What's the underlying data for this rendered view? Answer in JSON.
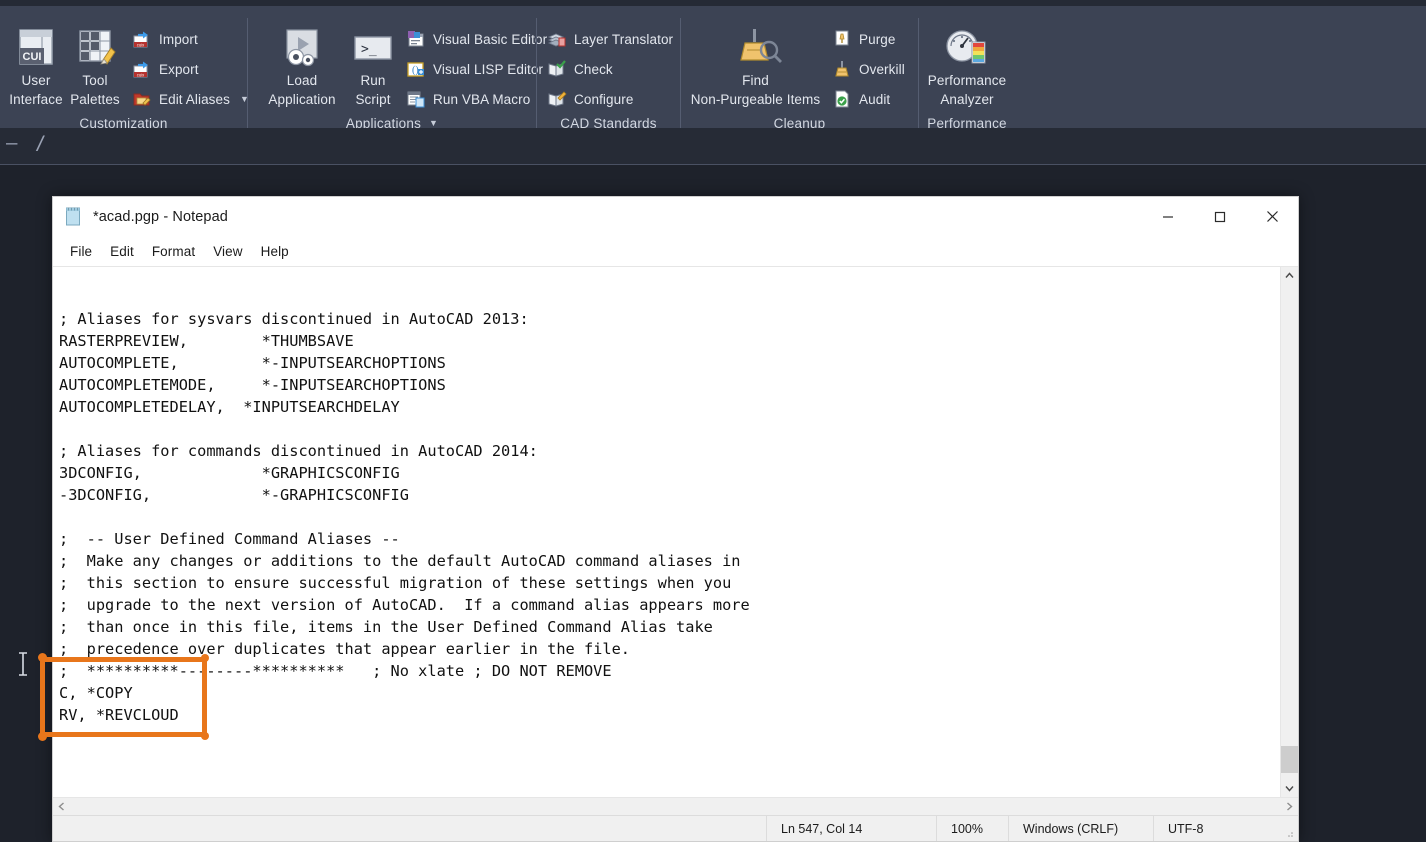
{
  "app": {
    "name": "AutoCAD",
    "command_prompt": "–  /"
  },
  "ribbon": {
    "panels": [
      {
        "id": "customization",
        "title": "Customization",
        "has_dropdown": false,
        "big_buttons": [
          {
            "icon": "cui-user-interface-icon",
            "label_line1": "User",
            "label_line2": "Interface"
          },
          {
            "icon": "tool-palettes-icon",
            "label_line1": "Tool",
            "label_line2": "Palettes"
          }
        ],
        "small_buttons": [
          {
            "icon": "import-cuix-icon",
            "label": "Import",
            "dropdown": false
          },
          {
            "icon": "export-cuix-icon",
            "label": "Export",
            "dropdown": false
          },
          {
            "icon": "edit-aliases-icon",
            "label": "Edit Aliases",
            "dropdown": true
          }
        ]
      },
      {
        "id": "applications",
        "title": "Applications",
        "has_dropdown": true,
        "big_buttons": [
          {
            "icon": "load-application-icon",
            "label_line1": "Load",
            "label_line2": "Application"
          },
          {
            "icon": "run-script-icon",
            "label_line1": "Run",
            "label_line2": "Script"
          }
        ],
        "small_buttons": [
          {
            "icon": "visual-basic-editor-icon",
            "label": "Visual Basic Editor",
            "dropdown": false
          },
          {
            "icon": "visual-lisp-editor-icon",
            "label": "Visual LISP Editor",
            "dropdown": false
          },
          {
            "icon": "run-vba-macro-icon",
            "label": "Run VBA Macro",
            "dropdown": false
          }
        ]
      },
      {
        "id": "cad-standards",
        "title": "CAD Standards",
        "has_dropdown": false,
        "big_buttons": [],
        "small_buttons": [
          {
            "icon": "layer-translator-icon",
            "label": "Layer Translator",
            "dropdown": false
          },
          {
            "icon": "check-standards-icon",
            "label": "Check",
            "dropdown": false
          },
          {
            "icon": "configure-standards-icon",
            "label": "Configure",
            "dropdown": false
          }
        ]
      },
      {
        "id": "cleanup",
        "title": "Cleanup",
        "has_dropdown": false,
        "big_buttons": [
          {
            "icon": "find-non-purgeable-items-icon",
            "label_line1": "Find",
            "label_line2": "Non-Purgeable Items"
          }
        ],
        "small_buttons": [
          {
            "icon": "purge-icon",
            "label": "Purge",
            "dropdown": false
          },
          {
            "icon": "overkill-icon",
            "label": "Overkill",
            "dropdown": false
          },
          {
            "icon": "audit-icon",
            "label": "Audit",
            "dropdown": false
          }
        ]
      },
      {
        "id": "performance",
        "title": "Performance",
        "has_dropdown": false,
        "big_buttons": [
          {
            "icon": "performance-analyzer-icon",
            "label_line1": "Performance",
            "label_line2": "Analyzer"
          }
        ],
        "small_buttons": []
      }
    ]
  },
  "notepad": {
    "title": "*acad.pgp - Notepad",
    "icon": "notepad-icon",
    "window_buttons": {
      "minimize": "minimize-icon",
      "maximize": "maximize-icon",
      "close": "close-icon"
    },
    "menu": [
      "File",
      "Edit",
      "Format",
      "View",
      "Help"
    ],
    "text": "\n; Aliases for sysvars discontinued in AutoCAD 2013:\nRASTERPREVIEW,        *THUMBSAVE\nAUTOCOMPLETE,         *-INPUTSEARCHOPTIONS\nAUTOCOMPLETEMODE,     *-INPUTSEARCHOPTIONS\nAUTOCOMPLETEDELAY,  *INPUTSEARCHDELAY\n\n; Aliases for commands discontinued in AutoCAD 2014:\n3DCONFIG,             *GRAPHICSCONFIG\n-3DCONFIG,            *-GRAPHICSCONFIG\n\n;  -- User Defined Command Aliases --\n;  Make any changes or additions to the default AutoCAD command aliases in\n;  this section to ensure successful migration of these settings when you\n;  upgrade to the next version of AutoCAD.  If a command alias appears more\n;  than once in this file, items in the User Defined Command Alias take\n;  precedence over duplicates that appear earlier in the file.\n;  **********--------**********   ; No xlate ; DO NOT REMOVE\nC, *COPY\nRV, *REVCLOUD",
    "statusbar": {
      "position": "Ln 547, Col 14",
      "zoom": "100%",
      "line_ending": "Windows (CRLF)",
      "encoding": "UTF-8"
    },
    "scrollbars": {
      "vertical_up": "chevron-up-icon",
      "vertical_down": "chevron-down-icon",
      "horizontal_left": "chevron-left-icon",
      "horizontal_right": "chevron-right-icon"
    }
  },
  "annotation": {
    "color": "#e8761b",
    "shape": "rectangle-highlight"
  },
  "colors": {
    "ribbon_bg": "#3c4354",
    "panel_label_bg": "#3a4152",
    "drawing_bg": "#1e222b",
    "notepad_bg": "#ffffff",
    "annotation_orange": "#e8761b"
  }
}
